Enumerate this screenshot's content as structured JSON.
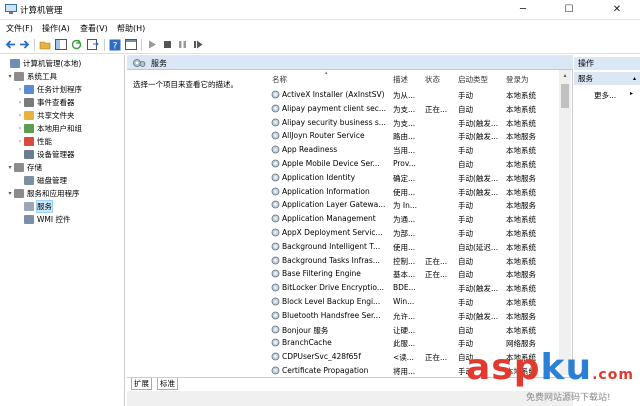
{
  "window": {
    "title": "计算机管理",
    "min_glyph": "─",
    "max_glyph": "☐",
    "close_glyph": "✕"
  },
  "menu": [
    "文件(F)",
    "操作(A)",
    "查看(V)",
    "帮助(H)"
  ],
  "tree": {
    "items": [
      {
        "label": "计算机管理(本地)",
        "exp": "",
        "color": "#6c8fb5",
        "indent": 0
      },
      {
        "label": "系统工具",
        "exp": "▾",
        "color": "#8c8c8c",
        "indent": 1
      },
      {
        "label": "任务计划程序",
        "exp": "›",
        "color": "#5b8bd0",
        "indent": 2
      },
      {
        "label": "事件查看器",
        "exp": "›",
        "color": "#7a7a7a",
        "indent": 2
      },
      {
        "label": "共享文件夹",
        "exp": "›",
        "color": "#e8b23f",
        "indent": 2
      },
      {
        "label": "本地用户和组",
        "exp": "›",
        "color": "#5e9c52",
        "indent": 2
      },
      {
        "label": "性能",
        "exp": "›",
        "color": "#d84b3b",
        "indent": 2
      },
      {
        "label": "设备管理器",
        "exp": "",
        "color": "#6b7c93",
        "indent": 2
      },
      {
        "label": "存储",
        "exp": "▾",
        "color": "#8c8c8c",
        "indent": 1
      },
      {
        "label": "磁盘管理",
        "exp": "",
        "color": "#7c8fa3",
        "indent": 2
      },
      {
        "label": "服务和应用程序",
        "exp": "▾",
        "color": "#8c8c8c",
        "indent": 1
      },
      {
        "label": "服务",
        "exp": "",
        "color": "#9aa7b5",
        "indent": 2,
        "selected": true
      },
      {
        "label": "WMI 控件",
        "exp": "",
        "color": "#7b8fa8",
        "indent": 2
      }
    ]
  },
  "center": {
    "header": "服务",
    "description": "选择一个项目来查看它的描述。",
    "columns": [
      "名称",
      "描述",
      "状态",
      "启动类型",
      "登录为"
    ],
    "rows": [
      [
        "ActiveX Installer (AxInstSV)",
        "为从...",
        "",
        "手动",
        "本地系统"
      ],
      [
        "Alipay payment client sec...",
        "为支...",
        "正在...",
        "自动",
        "本地系统"
      ],
      [
        "Alipay security business s...",
        "为支...",
        "",
        "手动(触发...",
        "本地系统"
      ],
      [
        "AllJoyn Router Service",
        "路由...",
        "",
        "手动(触发...",
        "本地服务"
      ],
      [
        "App Readiness",
        "当用...",
        "",
        "手动",
        "本地系统"
      ],
      [
        "Apple Mobile Device Ser...",
        "Prov...",
        "",
        "自动",
        "本地系统"
      ],
      [
        "Application Identity",
        "确定...",
        "",
        "手动(触发...",
        "本地服务"
      ],
      [
        "Application Information",
        "使用...",
        "",
        "手动(触发...",
        "本地系统"
      ],
      [
        "Application Layer Gatewa...",
        "为 In...",
        "",
        "手动",
        "本地服务"
      ],
      [
        "Application Management",
        "为通...",
        "",
        "手动",
        "本地系统"
      ],
      [
        "AppX Deployment Servic...",
        "为部...",
        "",
        "手动",
        "本地系统"
      ],
      [
        "Background Intelligent T...",
        "使用...",
        "",
        "自动(延迟...",
        "本地系统"
      ],
      [
        "Background Tasks Infras...",
        "控制...",
        "正在...",
        "自动",
        "本地系统"
      ],
      [
        "Base Filtering Engine",
        "基本...",
        "正在...",
        "自动",
        "本地服务"
      ],
      [
        "BitLocker Drive Encryptio...",
        "BDE...",
        "",
        "手动(触发...",
        "本地系统"
      ],
      [
        "Block Level Backup Engi...",
        "Win...",
        "",
        "手动",
        "本地系统"
      ],
      [
        "Bluetooth Handsfree Ser...",
        "允许...",
        "",
        "手动(触发...",
        "本地服务"
      ],
      [
        "Bonjour 服务",
        "让硬...",
        "",
        "自动",
        "本地系统"
      ],
      [
        "BranchCache",
        "此服...",
        "",
        "手动",
        "网络服务"
      ],
      [
        "CDPUserSvc_428f65f",
        "<读...",
        "正在...",
        "自动",
        "本地系统"
      ],
      [
        "Certificate Propagation",
        "将用...",
        "",
        "手动",
        "本地系统"
      ]
    ]
  },
  "tabs": [
    "扩展",
    "标准"
  ],
  "actions": {
    "header": "操作",
    "sub": "服务",
    "more": "更多...",
    "arrow_up": "▴",
    "arrow_right": "▸"
  },
  "watermark": {
    "main_a": "asp",
    "main_k": "ku",
    "main_b": ".com",
    "cn": "免费网站源码下载站!"
  }
}
